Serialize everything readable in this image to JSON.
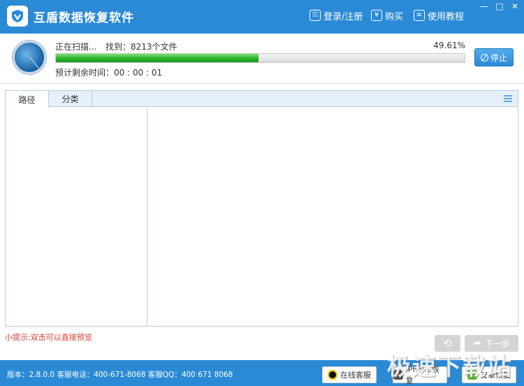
{
  "titlebar": {
    "title": "互盾数据恢复软件",
    "login_label": "登录/注册",
    "buy_label": "购买",
    "buy_symbol": "¥",
    "tutorial_label": "使用教程",
    "min_symbol": "—",
    "max_symbol": "□",
    "close_symbol": "✕"
  },
  "scan": {
    "status": "正在扫描...",
    "found": "找到：8213个文件",
    "percent": "49.61%",
    "progress": 0.4961,
    "remaining": "预计剩余时间：00 : 00 : 01",
    "stop_label": "停止"
  },
  "tabs": [
    {
      "label": "路径",
      "active": true
    },
    {
      "label": "分类",
      "active": false
    }
  ],
  "tip": "小提示:双击可以直接预览",
  "nav": {
    "back_symbol": "⟲",
    "next_label": "下一步"
  },
  "status": {
    "text": "版本：2.8.0.0  客服电话：400-671-8068    客服QQ：400 671 8068",
    "online_service_label": "在线客服",
    "iphone_recovery_label": "iPhone恢复",
    "android_recovery_label": "安卓恢复"
  },
  "watermark": "极速下载站",
  "colors": {
    "accent": "#2b8ad6",
    "progress": "#2fb52b",
    "tip": "#e03c2f"
  }
}
